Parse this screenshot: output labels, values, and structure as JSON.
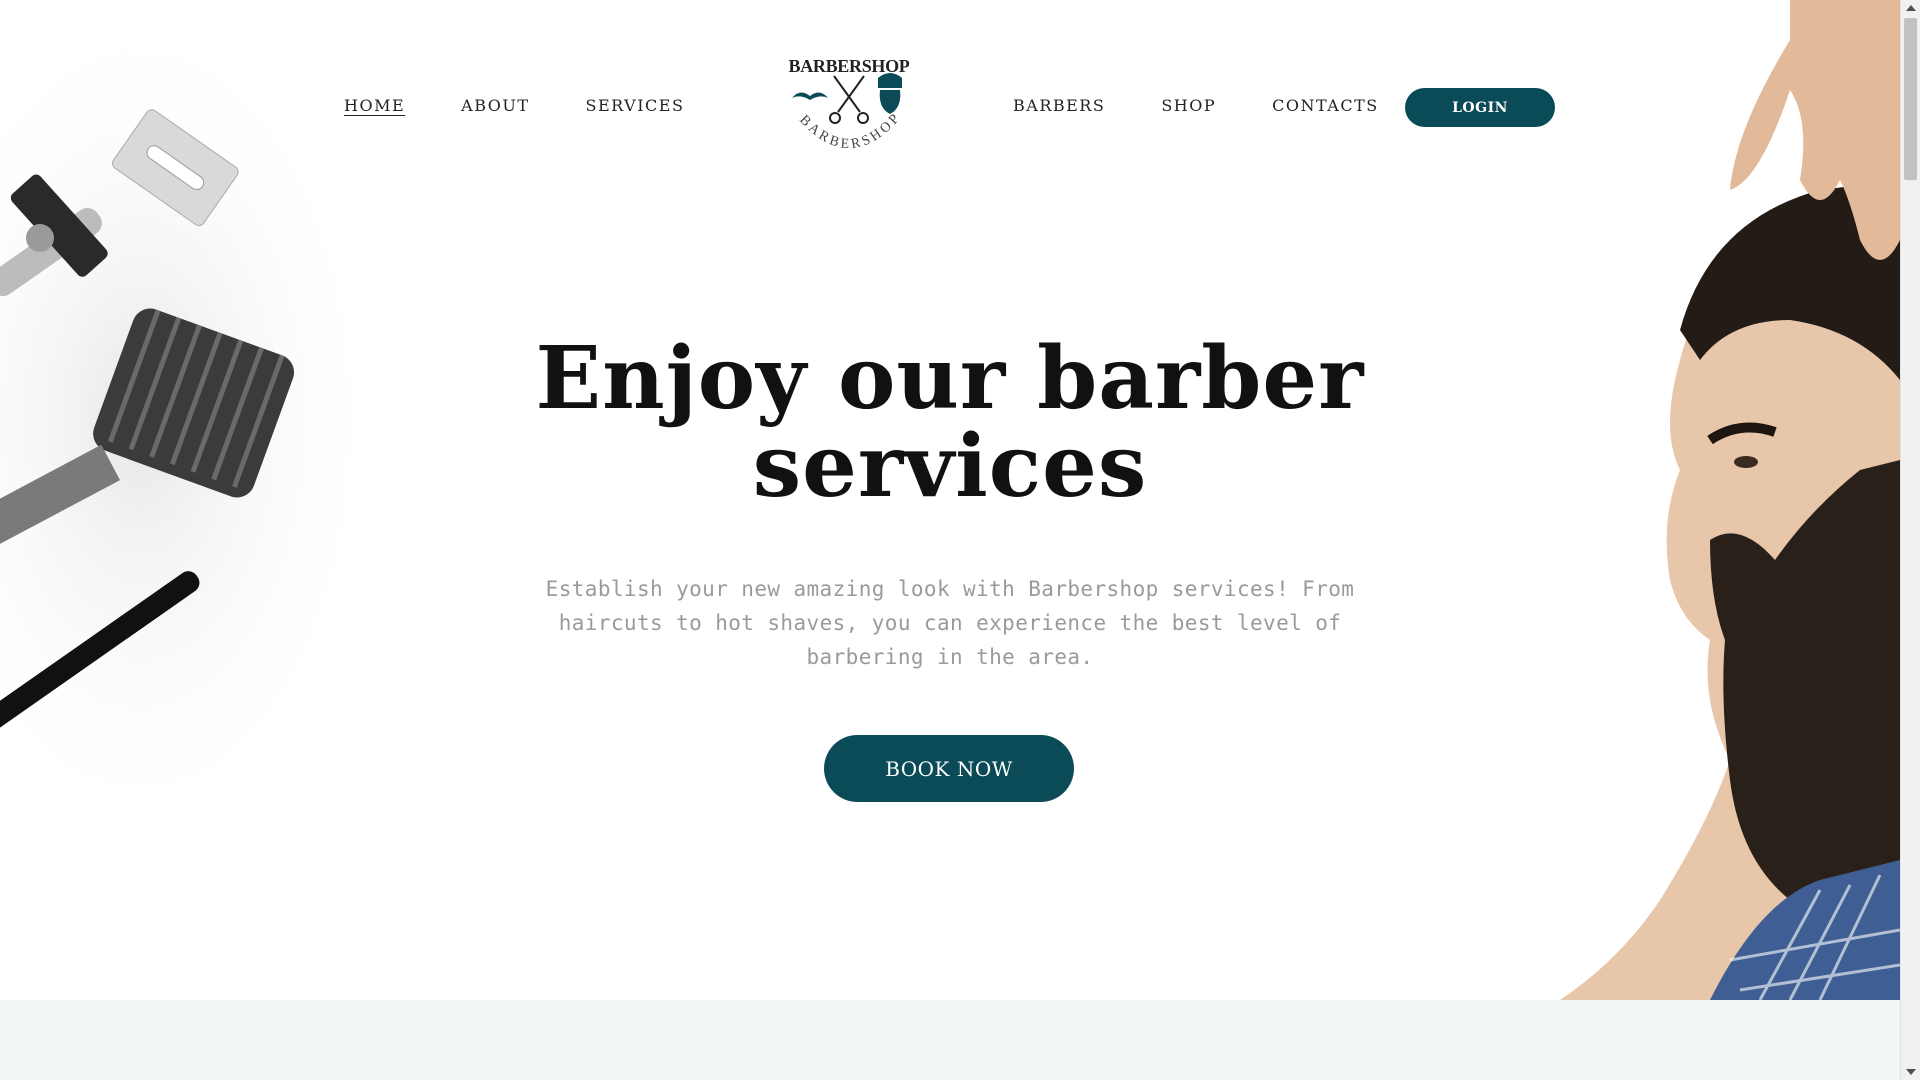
{
  "nav": {
    "left": [
      {
        "label": "HOME",
        "active": true
      },
      {
        "label": "ABOUT"
      },
      {
        "label": "SERVICES"
      }
    ],
    "right": [
      {
        "label": "BARBERS"
      },
      {
        "label": "SHOP"
      },
      {
        "label": "CONTACTS"
      }
    ],
    "login_label": "LOGIN"
  },
  "logo": {
    "title": "BARBERSHOP",
    "arc_text": "BARBERSHOP",
    "accent_color": "#0b4a57"
  },
  "hero": {
    "title_line1": "Enjoy our barber",
    "title_line2": "services",
    "description": "Establish your new amazing look with Barbershop services! From haircuts to hot shaves, you can experience the best level of barbering in the area.",
    "cta_label": "BOOK NOW"
  },
  "colors": {
    "primary": "#0b4a57",
    "text_muted": "#9a9a9a",
    "band": "#f3f6f7"
  }
}
